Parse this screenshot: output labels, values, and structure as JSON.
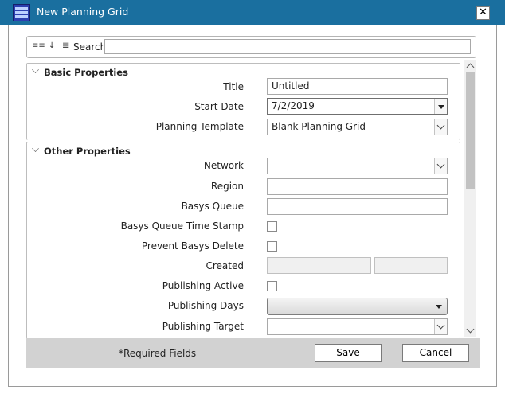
{
  "window": {
    "title": "New Planning Grid",
    "close_glyph": "✕"
  },
  "toolbar": {
    "search_label": "Search:",
    "search_value": "",
    "icons": [
      "categorize-icon",
      "sort-icon",
      "list-icon"
    ]
  },
  "basic": {
    "header": "Basic Properties",
    "title_label": "Title",
    "title_value": "Untitled",
    "start_date_label": "Start Date",
    "start_date_value": "7/2/2019",
    "template_label": "Planning Template",
    "template_value": "Blank Planning Grid"
  },
  "other": {
    "header": "Other Properties",
    "network_label": "Network",
    "network_value": "",
    "region_label": "Region",
    "region_value": "",
    "basys_queue_label": "Basys Queue",
    "basys_queue_value": "",
    "basys_queue_ts_label": "Basys Queue Time Stamp",
    "basys_queue_ts_checked": false,
    "prevent_delete_label": "Prevent Basys Delete",
    "prevent_delete_checked": false,
    "created_label": "Created",
    "publishing_active_label": "Publishing Active",
    "publishing_active_checked": false,
    "publishing_days_label": "Publishing Days",
    "publishing_target_label": "Publishing Target",
    "publishing_target_value": ""
  },
  "footer": {
    "required_text": "*Required Fields",
    "save_label": "Save",
    "cancel_label": "Cancel"
  }
}
